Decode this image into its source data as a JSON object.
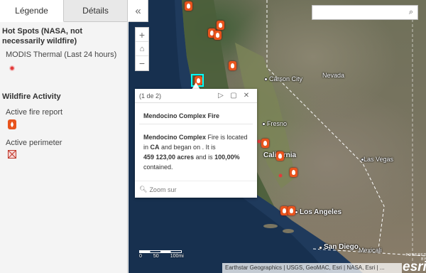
{
  "panel": {
    "tabs": [
      {
        "label": "Légende",
        "active": true
      },
      {
        "label": "Détails",
        "active": false
      }
    ],
    "legend": {
      "layer1": {
        "title": "Hot Spots (NASA, not necessarily wildfire)",
        "sublabel": "MODIS Thermal (Last 24 hours)"
      },
      "layer2": {
        "title": "Wildfire Activity",
        "items": [
          {
            "label": "Active fire report",
            "icon": "fire-icon"
          },
          {
            "label": "Active perimeter",
            "icon": "perimeter-icon"
          }
        ]
      }
    }
  },
  "collapse_icon": "«",
  "search": {
    "icon": "⌕"
  },
  "zoom": {
    "plus": "+",
    "home": "⌂",
    "minus": "−"
  },
  "map": {
    "places": {
      "carson_city": "Carson City",
      "nevada": "Nevada",
      "fresno": "Fresno",
      "california": "California",
      "las_vegas": "Las Vegas",
      "los_angeles": "Los Angeles",
      "san_diego": "San Diego",
      "mexicali": "Mexicali"
    }
  },
  "popup": {
    "count": "(1 de 2)",
    "next": "▷",
    "maximize": "▢",
    "close": "✕",
    "title": "Mendocino Complex Fire",
    "body": {
      "name": "Mendocino Complex",
      "t1": " Fire is located in ",
      "state": "CA",
      "t2": " and began on . It is",
      "acres": "459 123,00 acres",
      "t3": " and is ",
      "percent": "100,00%",
      "t4": "contained."
    },
    "zoom_label": "Zoom sur"
  },
  "scale": {
    "l0": "0",
    "l1": "50",
    "l2": "100mi"
  },
  "attribution": "Earthstar Geographics | USGS, GeoMAC, Esri | NASA, Esri | ...",
  "esri": {
    "powered": "POWERED BY",
    "logo": "esri"
  },
  "colors": {
    "fire": "#e8541d",
    "ocean": "#1f3a5c",
    "selection": "#00ffff"
  }
}
